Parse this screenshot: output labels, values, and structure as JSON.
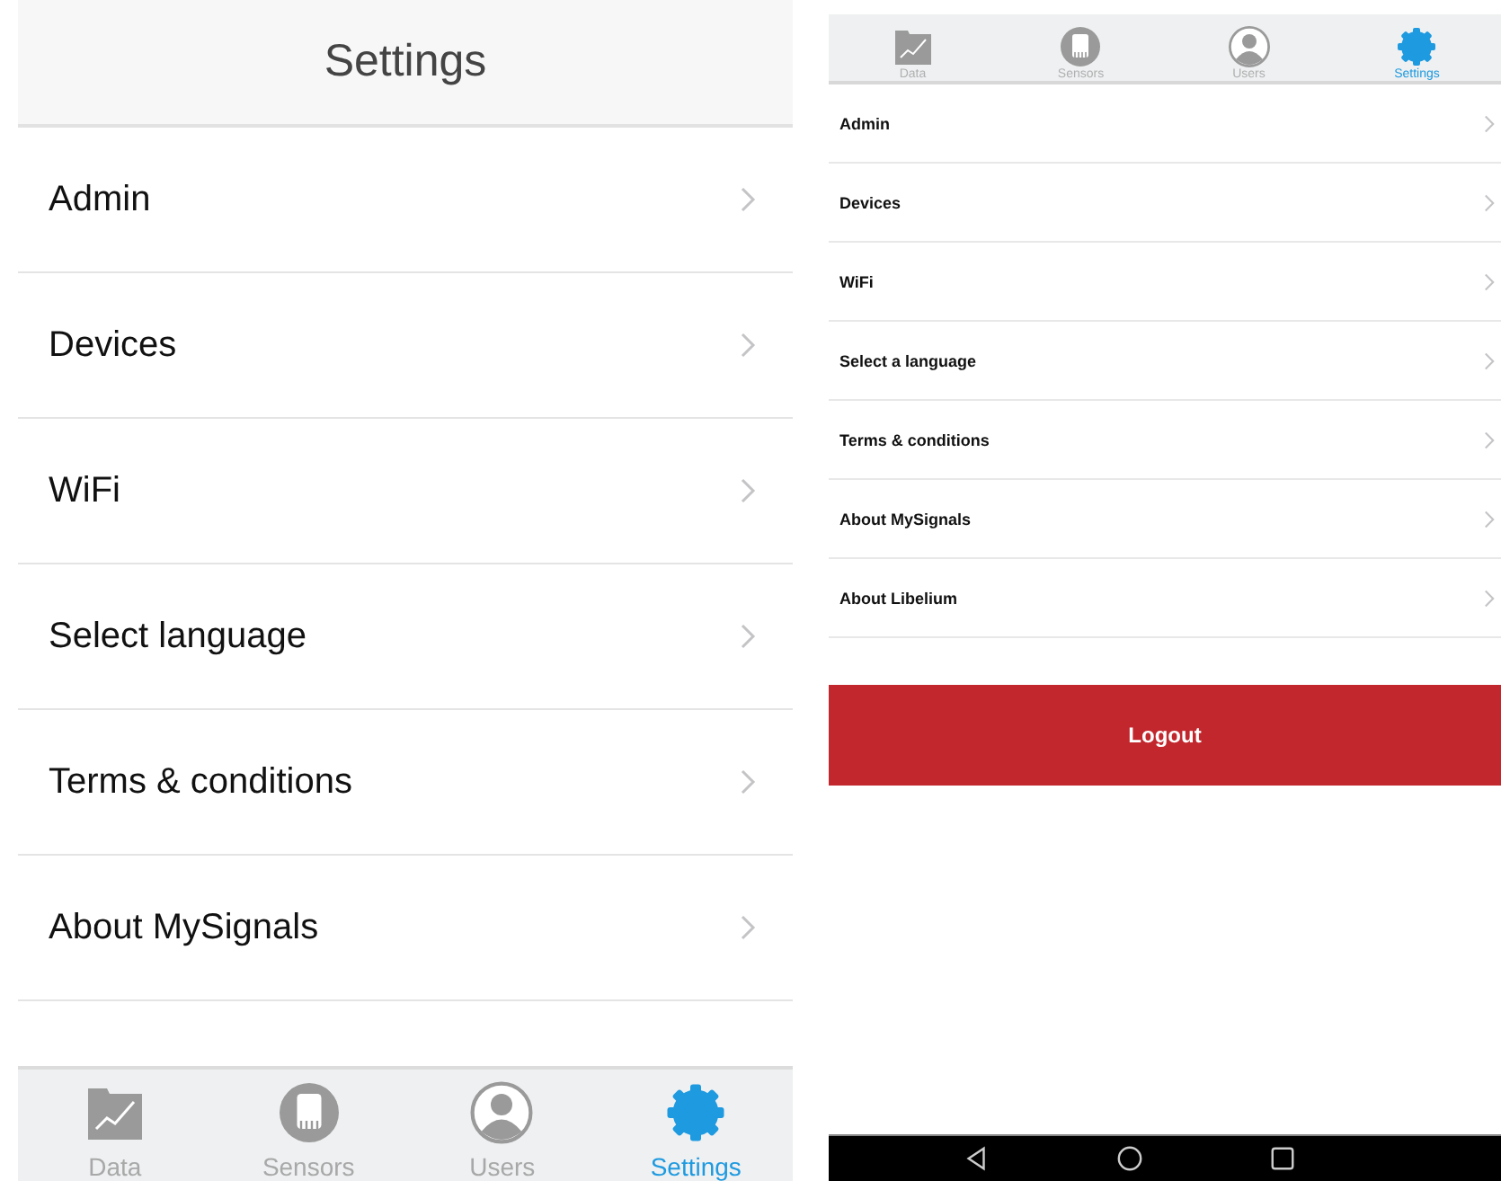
{
  "left_screen": {
    "title": "Settings",
    "items": [
      {
        "label": "Admin"
      },
      {
        "label": "Devices"
      },
      {
        "label": "WiFi"
      },
      {
        "label": "Select language"
      },
      {
        "label": "Terms & conditions"
      },
      {
        "label": "About MySignals"
      }
    ],
    "tabs": [
      {
        "kind": "data",
        "label": "Data",
        "selected": false
      },
      {
        "kind": "sensors",
        "label": "Sensors",
        "selected": false
      },
      {
        "kind": "users",
        "label": "Users",
        "selected": false
      },
      {
        "kind": "settings",
        "label": "Settings",
        "selected": true
      }
    ]
  },
  "right_screen": {
    "tabs": [
      {
        "kind": "data",
        "label": "Data",
        "selected": false
      },
      {
        "kind": "sensors",
        "label": "Sensors",
        "selected": false
      },
      {
        "kind": "users",
        "label": "Users",
        "selected": false
      },
      {
        "kind": "settings",
        "label": "Settings",
        "selected": true
      }
    ],
    "items": [
      {
        "label": "Admin"
      },
      {
        "label": "Devices"
      },
      {
        "label": "WiFi"
      },
      {
        "label": "Select a language"
      },
      {
        "label": "Terms & conditions"
      },
      {
        "label": "About MySignals"
      },
      {
        "label": "About Libelium"
      }
    ],
    "logout_button": "Logout"
  }
}
